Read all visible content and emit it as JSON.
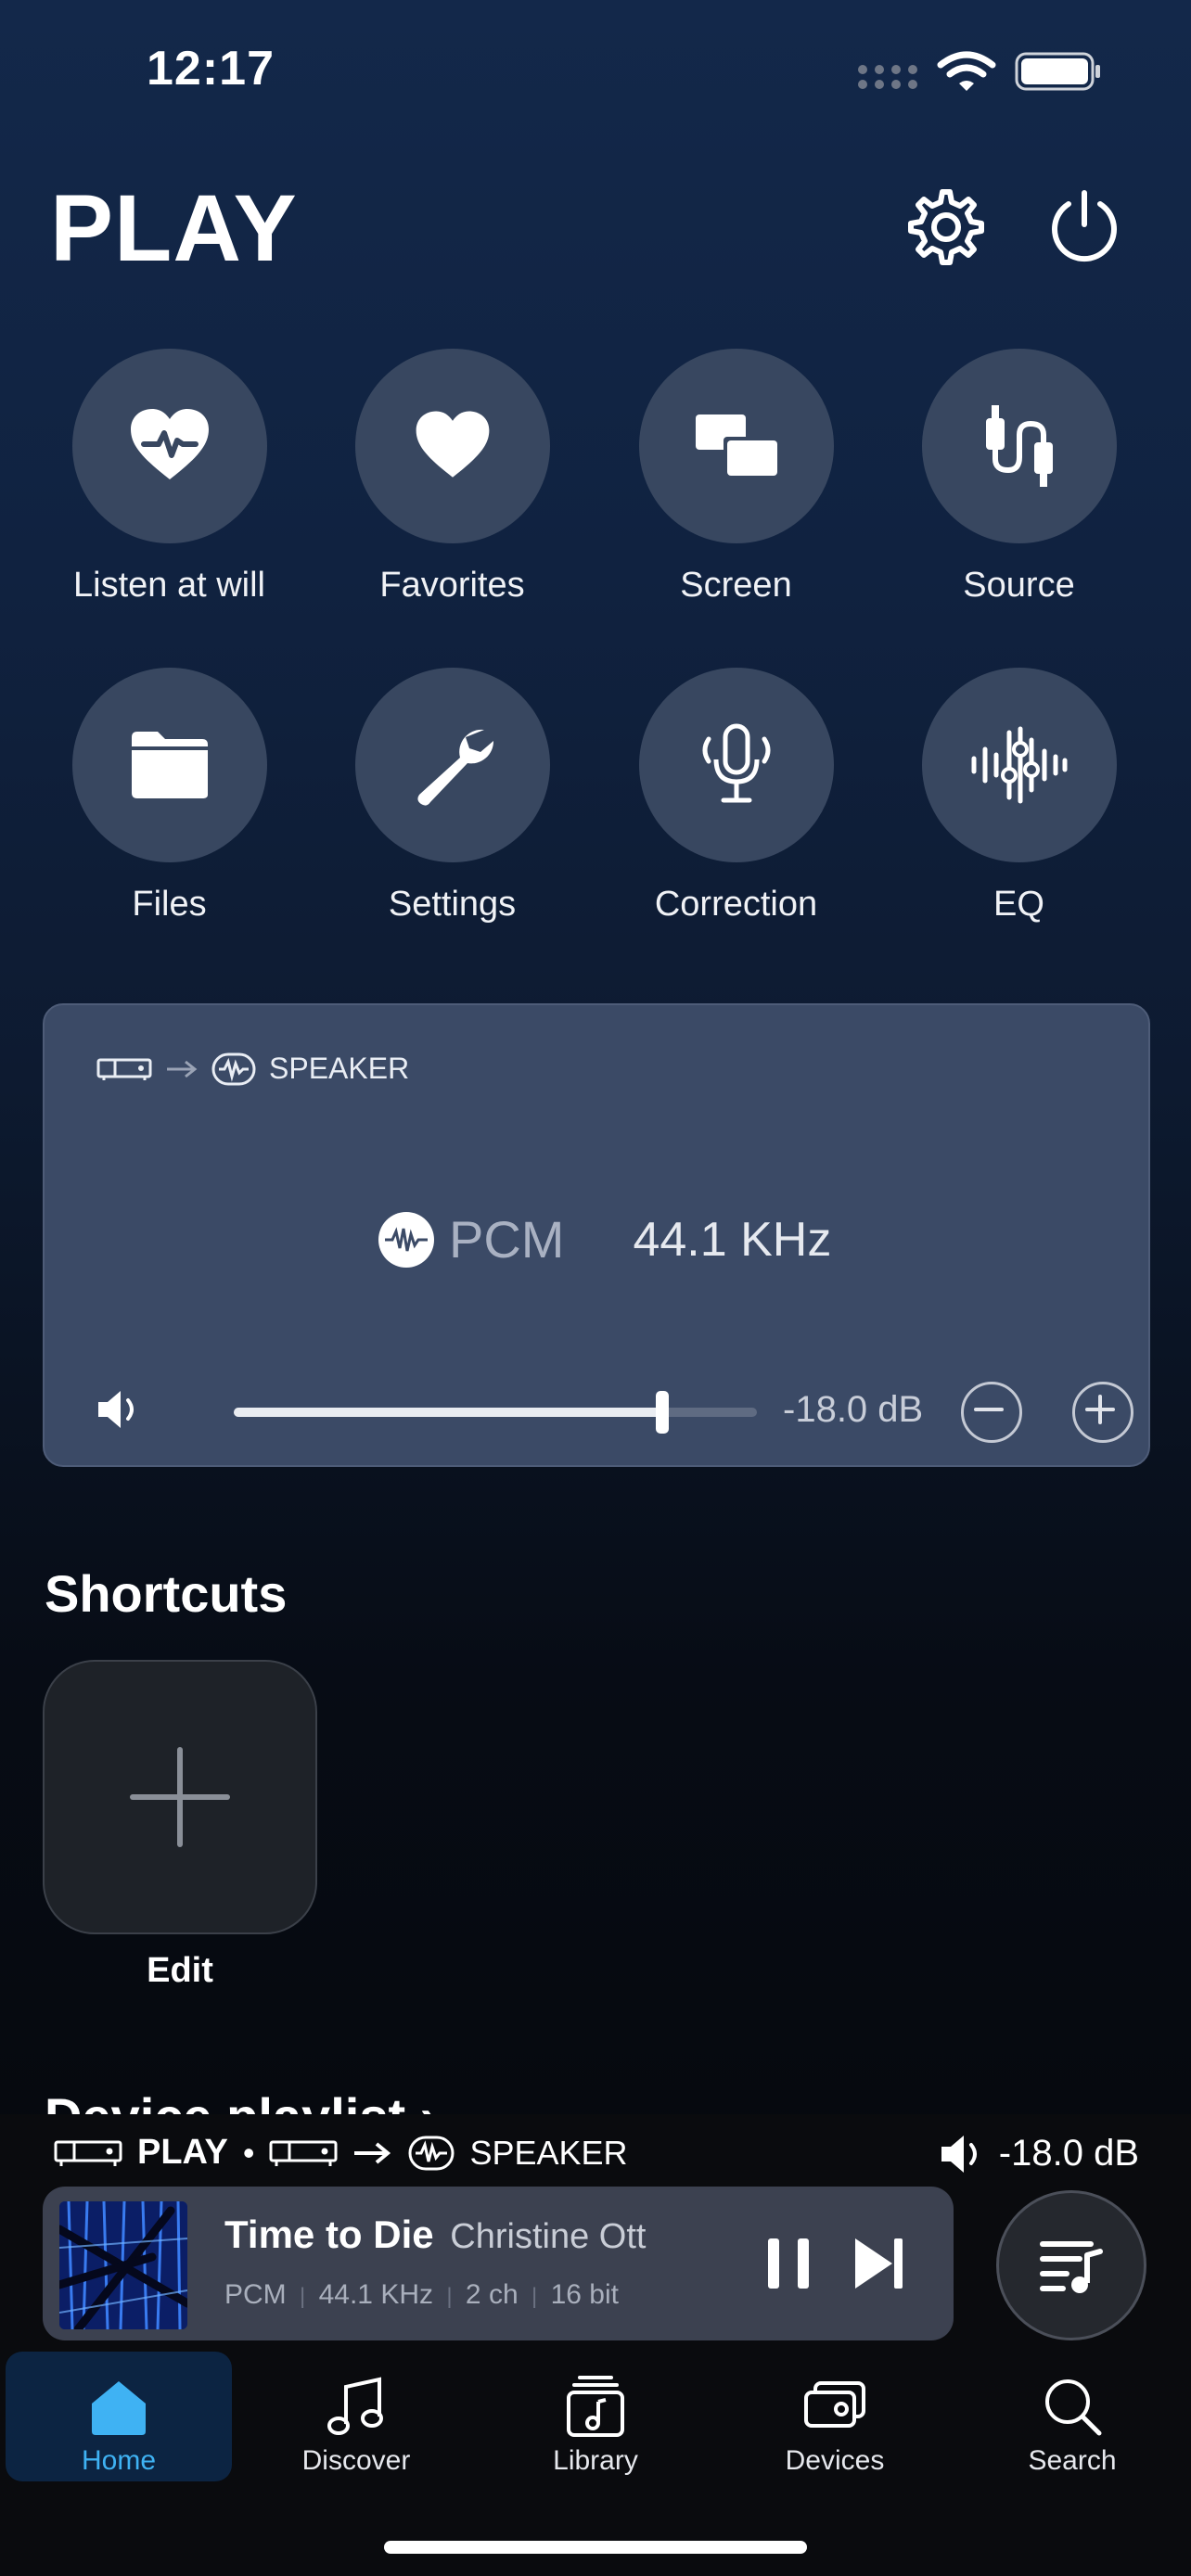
{
  "status_bar": {
    "time": "12:17",
    "icons": [
      "cellular-icon",
      "wifi-icon",
      "battery-icon"
    ]
  },
  "header": {
    "title": "PLAY",
    "icons": [
      "gear-icon",
      "power-icon"
    ]
  },
  "quick_actions": [
    {
      "label": "Listen at will",
      "icon": "heart-pulse-icon"
    },
    {
      "label": "Favorites",
      "icon": "heart-icon"
    },
    {
      "label": "Screen",
      "icon": "screen-icon"
    },
    {
      "label": "Source",
      "icon": "cable-icon"
    },
    {
      "label": "Files",
      "icon": "folder-icon"
    },
    {
      "label": "Settings",
      "icon": "wrench-icon"
    },
    {
      "label": "Correction",
      "icon": "microphone-icon"
    },
    {
      "label": "EQ",
      "icon": "equalizer-icon"
    }
  ],
  "device_card": {
    "route_target": "SPEAKER",
    "format": "PCM",
    "sample_rate": "44.1 KHz",
    "volume_db": "-18.0 dB",
    "volume_level": 0.82
  },
  "shortcuts": {
    "heading": "Shortcuts",
    "edit_label": "Edit"
  },
  "device_playlist": {
    "heading": "Device playlist ›"
  },
  "now_playing": {
    "route_source": "PLAY",
    "separator": "•",
    "route_target": "SPEAKER",
    "volume_db": "-18.0 dB",
    "track_title": "Time to Die",
    "artist": "Christine Ott",
    "meta": [
      "PCM",
      "44.1 KHz",
      "2 ch",
      "16 bit"
    ]
  },
  "tabs": [
    {
      "label": "Home",
      "icon": "home-icon",
      "active": true
    },
    {
      "label": "Discover",
      "icon": "music-note-icon",
      "active": false
    },
    {
      "label": "Library",
      "icon": "library-icon",
      "active": false
    },
    {
      "label": "Devices",
      "icon": "devices-icon",
      "active": false
    },
    {
      "label": "Search",
      "icon": "search-icon",
      "active": false
    }
  ],
  "colors": {
    "accent": "#3fb2f3",
    "tile": "#384760",
    "card": "#3b4a66"
  }
}
